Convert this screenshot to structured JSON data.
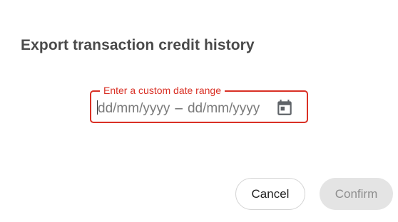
{
  "dialog": {
    "title": "Export transaction credit history",
    "date_range": {
      "label": "Enter a custom date range",
      "start_placeholder": "dd/mm/yyyy",
      "separator": "–",
      "end_placeholder": "dd/mm/yyyy",
      "calendar_icon": "calendar-icon"
    },
    "actions": {
      "cancel_label": "Cancel",
      "confirm_label": "Confirm"
    }
  },
  "colors": {
    "error_accent": "#d93025",
    "title_text": "#4a4a4a",
    "disabled_button_bg": "#e4e4e4",
    "disabled_button_text": "#8e8e8e"
  }
}
